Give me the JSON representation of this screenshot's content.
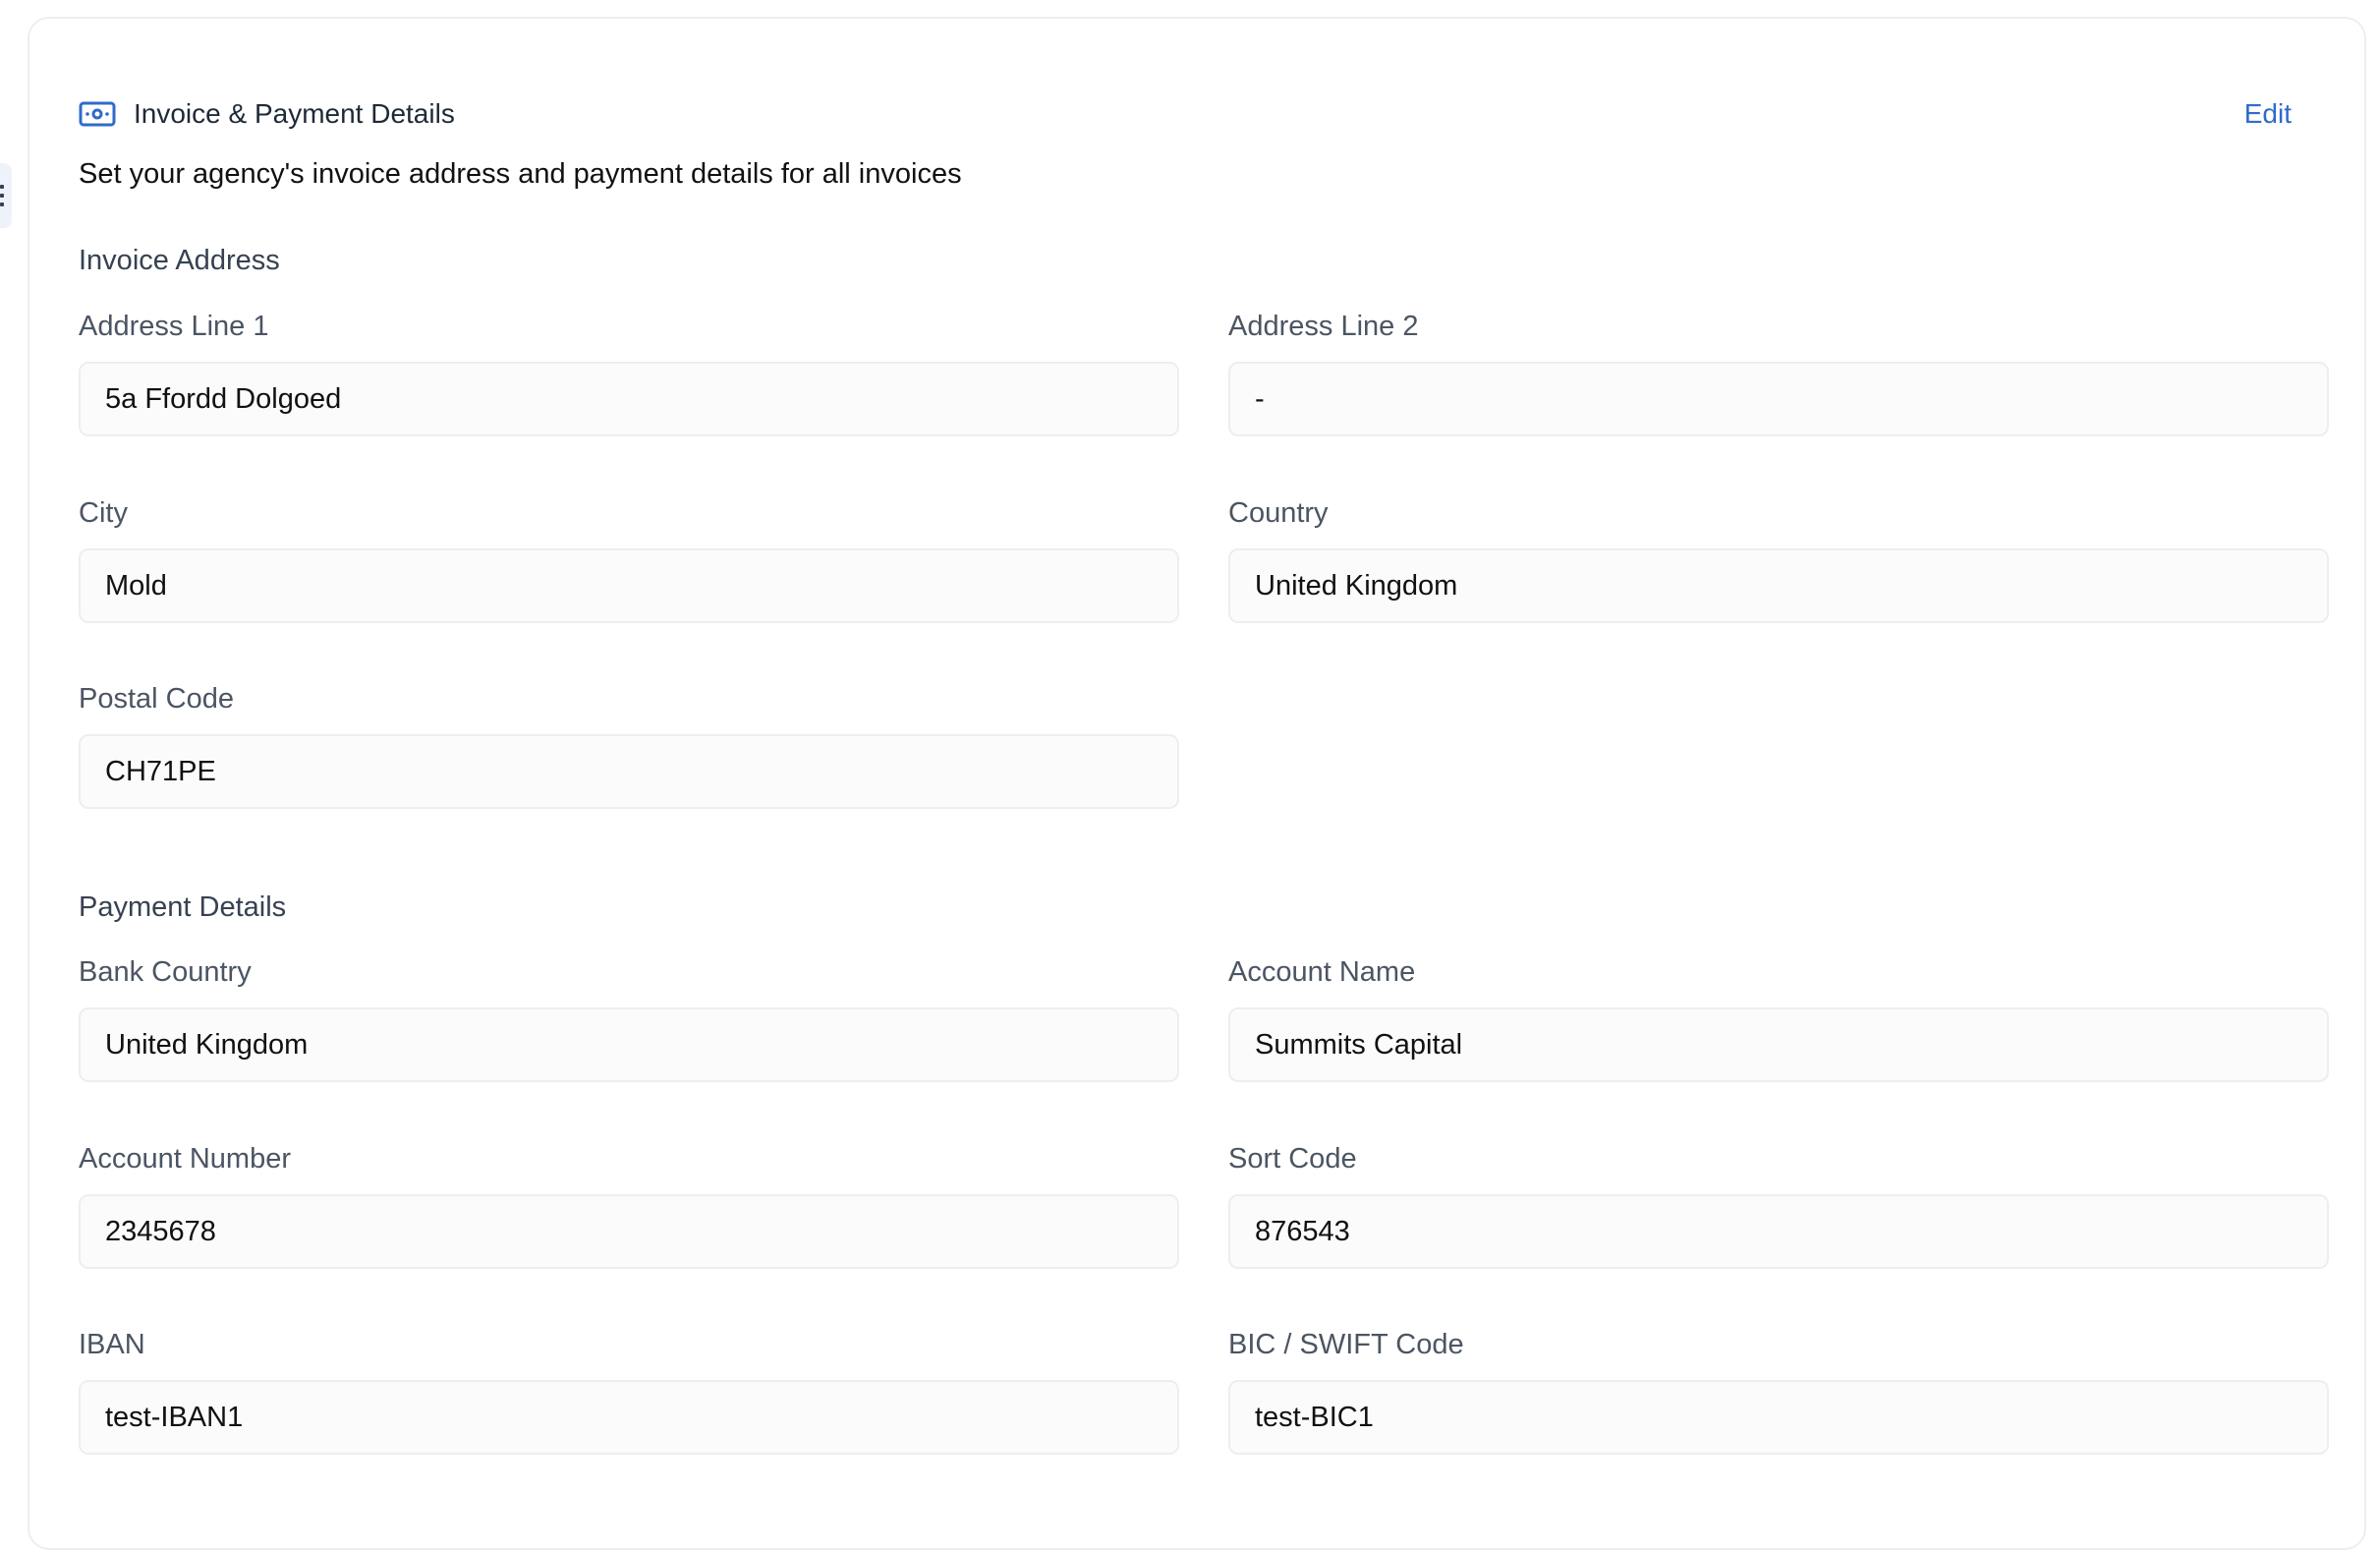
{
  "header": {
    "title": "Invoice & Payment Details",
    "edit_label": "Edit",
    "subtitle": "Set your agency's invoice address and payment details for all invoices",
    "icon": "money-icon",
    "accent_color": "#2f6bcb"
  },
  "invoice_address": {
    "title": "Invoice Address",
    "address_line_1": {
      "label": "Address Line 1",
      "value": "5a Ffordd Dolgoed"
    },
    "address_line_2": {
      "label": "Address Line 2",
      "value": "-"
    },
    "city": {
      "label": "City",
      "value": "Mold"
    },
    "country": {
      "label": "Country",
      "value": "United Kingdom"
    },
    "postal_code": {
      "label": "Postal Code",
      "value": "CH71PE"
    }
  },
  "payment_details": {
    "title": "Payment Details",
    "bank_country": {
      "label": "Bank Country",
      "value": "United Kingdom"
    },
    "account_name": {
      "label": "Account Name",
      "value": "Summits Capital"
    },
    "account_number": {
      "label": "Account Number",
      "value": "2345678"
    },
    "sort_code": {
      "label": "Sort Code",
      "value": "876543"
    },
    "iban": {
      "label": "IBAN",
      "value": "test-IBAN1"
    },
    "bic_swift": {
      "label": "BIC / SWIFT Code",
      "value": "test-BIC1"
    }
  }
}
